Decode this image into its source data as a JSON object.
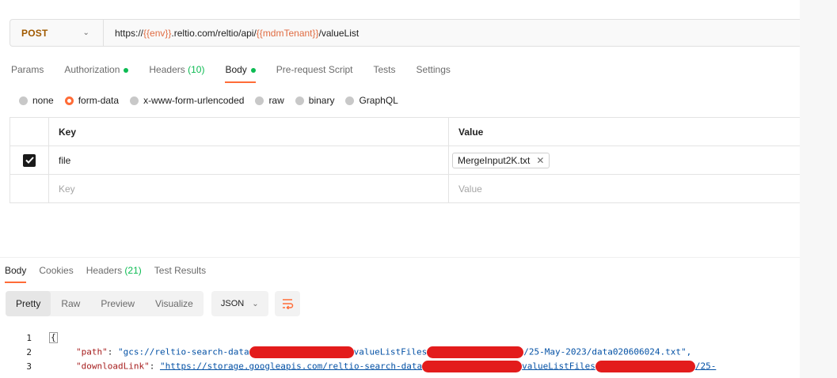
{
  "request": {
    "method": "POST",
    "url_parts": [
      {
        "text": "https://",
        "var": false
      },
      {
        "text": "{{env}}",
        "var": true
      },
      {
        "text": ".reltio.com/reltio/api/",
        "var": false
      },
      {
        "text": "{{mdmTenant}}",
        "var": true
      },
      {
        "text": "/valueList",
        "var": false
      }
    ]
  },
  "request_tabs": [
    {
      "label": "Params",
      "active": false,
      "dot": false,
      "count": ""
    },
    {
      "label": "Authorization",
      "active": false,
      "dot": true,
      "count": ""
    },
    {
      "label": "Headers",
      "active": false,
      "dot": false,
      "count": "(10)"
    },
    {
      "label": "Body",
      "active": true,
      "dot": true,
      "count": ""
    },
    {
      "label": "Pre-request Script",
      "active": false,
      "dot": false,
      "count": ""
    },
    {
      "label": "Tests",
      "active": false,
      "dot": false,
      "count": ""
    },
    {
      "label": "Settings",
      "active": false,
      "dot": false,
      "count": ""
    }
  ],
  "body_types": [
    {
      "label": "none",
      "selected": false
    },
    {
      "label": "form-data",
      "selected": true
    },
    {
      "label": "x-www-form-urlencoded",
      "selected": false
    },
    {
      "label": "raw",
      "selected": false
    },
    {
      "label": "binary",
      "selected": false
    },
    {
      "label": "GraphQL",
      "selected": false
    }
  ],
  "form_table": {
    "headers": {
      "key": "Key",
      "value": "Value"
    },
    "rows": [
      {
        "checked": true,
        "key": "file",
        "value": "MergeInput2K.txt"
      }
    ],
    "placeholder": {
      "key": "Key",
      "value": "Value"
    }
  },
  "response_tabs": [
    {
      "label": "Body",
      "active": true,
      "count": ""
    },
    {
      "label": "Cookies",
      "active": false,
      "count": ""
    },
    {
      "label": "Headers",
      "active": false,
      "count": "(21)"
    },
    {
      "label": "Test Results",
      "active": false,
      "count": ""
    }
  ],
  "view_modes": [
    {
      "label": "Pretty",
      "active": true
    },
    {
      "label": "Raw",
      "active": false
    },
    {
      "label": "Preview",
      "active": false
    },
    {
      "label": "Visualize",
      "active": false
    }
  ],
  "format": "JSON",
  "code_lines": [
    {
      "num": "1",
      "text": "{"
    },
    {
      "num": "2",
      "key": "\"path\"",
      "value_start": "\"gcs://reltio-search-data",
      "value_mid": "valueListFiles",
      "value_end": "/25-May-2023/data020606024.txt\","
    },
    {
      "num": "3",
      "key": "\"downloadLink\"",
      "value_start": "\"https://storage.googleapis.com/reltio-search-data",
      "value_mid": "valueListFiles",
      "value_end": "/25-"
    }
  ],
  "colors": {
    "accent": "#ff6c37",
    "method": "#a05a00",
    "variable": "#e06c42",
    "indicator": "#0cbb52",
    "redaction": "#e31c1c"
  }
}
